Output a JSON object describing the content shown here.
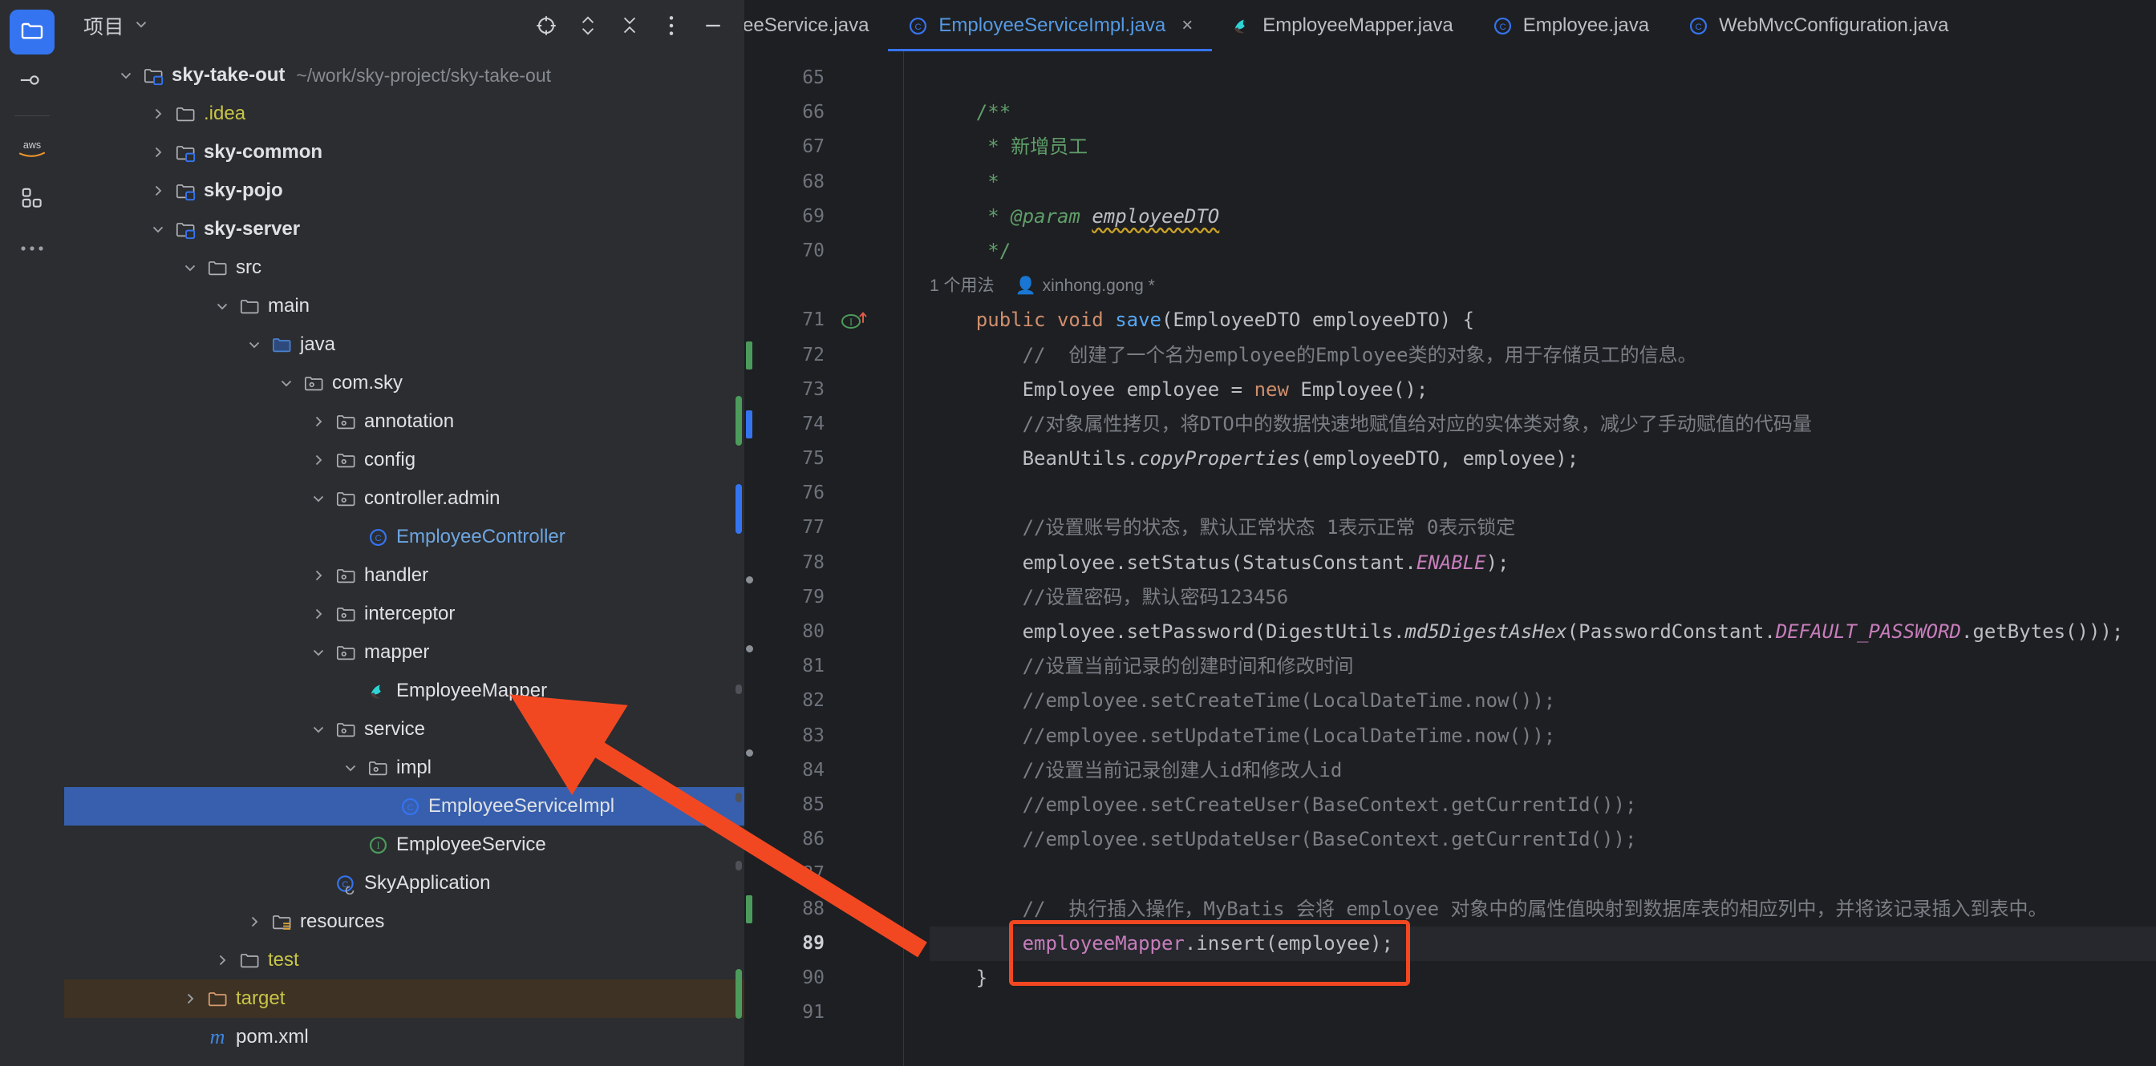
{
  "rail": {
    "items": [
      {
        "name": "project-tool-window",
        "icon": "folder-icon",
        "active": true
      },
      {
        "name": "commit-tool-window",
        "icon": "commit-icon",
        "active": false
      },
      {
        "name": "aws-toolkit",
        "icon": "aws-icon",
        "label": "aws",
        "active": false
      },
      {
        "name": "plugins-tool-window",
        "icon": "modules-icon",
        "active": false
      },
      {
        "name": "more-tool-windows",
        "icon": "more-dots-icon",
        "active": false
      }
    ]
  },
  "project_panel": {
    "title": "项目",
    "title_dropdown_icon": "chevron-down-icon",
    "header_icons": [
      {
        "name": "select-opened-file-icon",
        "glyph": "crosshair-icon"
      },
      {
        "name": "expand-collapse-icon",
        "glyph": "chevron-up-down-icon"
      },
      {
        "name": "collapse-all-icon",
        "glyph": "double-chevron-up-icon"
      },
      {
        "name": "options-menu-icon",
        "glyph": "vertical-dots-icon"
      },
      {
        "name": "hide-tool-window-icon",
        "glyph": "minus-icon"
      }
    ],
    "tree": [
      {
        "indent": 0,
        "arrow": "down",
        "icon": "module-folder",
        "label": "sky-take-out",
        "bold": true,
        "path": "~/work/sky-project/sky-take-out"
      },
      {
        "indent": 1,
        "arrow": "right",
        "icon": "folder",
        "label": ".idea",
        "color": "yellowish"
      },
      {
        "indent": 1,
        "arrow": "right",
        "icon": "module-folder",
        "label": "sky-common",
        "bold": true
      },
      {
        "indent": 1,
        "arrow": "right",
        "icon": "module-folder",
        "label": "sky-pojo",
        "bold": true
      },
      {
        "indent": 1,
        "arrow": "down",
        "icon": "module-folder",
        "label": "sky-server",
        "bold": true
      },
      {
        "indent": 2,
        "arrow": "down",
        "icon": "folder",
        "label": "src"
      },
      {
        "indent": 3,
        "arrow": "down",
        "icon": "folder",
        "label": "main"
      },
      {
        "indent": 4,
        "arrow": "down",
        "icon": "source-root-folder",
        "label": "java"
      },
      {
        "indent": 5,
        "arrow": "down",
        "icon": "package",
        "label": "com.sky"
      },
      {
        "indent": 6,
        "arrow": "right",
        "icon": "package",
        "label": "annotation"
      },
      {
        "indent": 6,
        "arrow": "right",
        "icon": "package",
        "label": "config"
      },
      {
        "indent": 6,
        "arrow": "down",
        "icon": "package",
        "label": "controller.admin"
      },
      {
        "indent": 7,
        "arrow": "none",
        "icon": "java-class",
        "label": "EmployeeController",
        "color": "classname"
      },
      {
        "indent": 6,
        "arrow": "right",
        "icon": "package",
        "label": "handler"
      },
      {
        "indent": 6,
        "arrow": "right",
        "icon": "package",
        "label": "interceptor"
      },
      {
        "indent": 6,
        "arrow": "down",
        "icon": "package",
        "label": "mapper"
      },
      {
        "indent": 7,
        "arrow": "none",
        "icon": "mybatis-mapper",
        "label": "EmployeeMapper"
      },
      {
        "indent": 6,
        "arrow": "down",
        "icon": "package",
        "label": "service"
      },
      {
        "indent": 7,
        "arrow": "down",
        "icon": "package",
        "label": "impl"
      },
      {
        "indent": 8,
        "arrow": "none",
        "icon": "java-class",
        "label": "EmployeeServiceImpl",
        "selected": true
      },
      {
        "indent": 7,
        "arrow": "none",
        "icon": "java-interface",
        "label": "EmployeeService"
      },
      {
        "indent": 6,
        "arrow": "none",
        "icon": "spring-boot-class",
        "label": "SkyApplication"
      },
      {
        "indent": 4,
        "arrow": "right",
        "icon": "resources-folder",
        "label": "resources"
      },
      {
        "indent": 3,
        "arrow": "right",
        "icon": "folder",
        "label": "test",
        "color": "yellowish"
      },
      {
        "indent": 2,
        "arrow": "right",
        "icon": "excluded-folder",
        "label": "target",
        "color": "yellowish",
        "excluded": true
      },
      {
        "indent": 2,
        "arrow": "none",
        "icon": "maven-file",
        "label": "pom.xml"
      }
    ]
  },
  "editor": {
    "tabs": [
      {
        "label": "yeeService.java",
        "icon": "java-interface",
        "active": false,
        "clipped": true,
        "closable": false
      },
      {
        "label": "EmployeeServiceImpl.java",
        "icon": "java-class",
        "active": true,
        "clipped": false,
        "closable": true,
        "close_label": "×"
      },
      {
        "label": "EmployeeMapper.java",
        "icon": "mybatis-mapper",
        "active": false,
        "clipped": false,
        "closable": false
      },
      {
        "label": "Employee.java",
        "icon": "java-class",
        "active": false,
        "clipped": false,
        "closable": false
      },
      {
        "label": "WebMvcConfiguration.java",
        "icon": "java-class",
        "active": false,
        "clipped": false,
        "closable": false
      }
    ],
    "first_line_number": 65,
    "line_numbers": [
      65,
      66,
      67,
      68,
      69,
      70,
      "",
      71,
      72,
      73,
      74,
      75,
      76,
      77,
      78,
      79,
      80,
      81,
      82,
      83,
      84,
      85,
      86,
      87,
      88,
      89,
      90,
      91
    ],
    "current_line": 89,
    "gutter": {
      "change_bars": [
        {
          "line": 72,
          "color": "#4C9B5C",
          "name": "added-line-marker"
        },
        {
          "line": 74,
          "color": "#3574F0",
          "name": "modified-line-marker"
        },
        {
          "line": 88,
          "color": "#4C9B5C",
          "name": "added-line-marker"
        }
      ],
      "fold_dots": [
        78,
        80,
        83
      ],
      "implementation_icon": {
        "line": 71,
        "name": "implementing-method-icon",
        "glyph": "I"
      }
    },
    "inlay_hints": {
      "usages": "1 个用法",
      "author": "xinhong.gong *",
      "author_icon": "person-icon"
    },
    "lines": [
      {
        "n": 65,
        "segments": []
      },
      {
        "n": 66,
        "segments": [
          {
            "c": "doc",
            "t": "    /**"
          }
        ]
      },
      {
        "n": 67,
        "segments": [
          {
            "c": "doc",
            "t": "     * 新增员工"
          }
        ]
      },
      {
        "n": 68,
        "segments": [
          {
            "c": "doc",
            "t": "     *"
          }
        ]
      },
      {
        "n": 69,
        "segments": [
          {
            "c": "doc",
            "t": "     * "
          },
          {
            "c": "doctag",
            "t": "@param "
          },
          {
            "c": "docpar",
            "t": "employeeDTO"
          }
        ]
      },
      {
        "n": 70,
        "segments": [
          {
            "c": "doc",
            "t": "     */"
          }
        ]
      },
      {
        "n": 71,
        "segments": [
          {
            "c": "kw",
            "t": "    public void "
          },
          {
            "c": "mth",
            "t": "save"
          },
          {
            "c": "txt",
            "t": "(EmployeeDTO employeeDTO) {"
          }
        ]
      },
      {
        "n": 72,
        "segments": [
          {
            "c": "cmt",
            "t": "        //  创建了一个名为employee的Employee类的对象，用于存储员工的信息。"
          }
        ]
      },
      {
        "n": 73,
        "segments": [
          {
            "c": "txt",
            "t": "        Employee employee = "
          },
          {
            "c": "kw",
            "t": "new "
          },
          {
            "c": "txt",
            "t": "Employee();"
          }
        ]
      },
      {
        "n": 74,
        "segments": [
          {
            "c": "cmt",
            "t": "        //对象属性拷贝，将DTO中的数据快速地赋值给对应的实体类对象，减少了手动赋值的代码量"
          }
        ]
      },
      {
        "n": 75,
        "segments": [
          {
            "c": "txt",
            "t": "        BeanUtils."
          },
          {
            "c": "static",
            "t": "copyProperties"
          },
          {
            "c": "txt",
            "t": "(employeeDTO, employee);"
          }
        ]
      },
      {
        "n": 76,
        "segments": []
      },
      {
        "n": 77,
        "segments": [
          {
            "c": "cmt",
            "t": "        //设置账号的状态，默认正常状态 1表示正常 0表示锁定"
          }
        ]
      },
      {
        "n": 78,
        "segments": [
          {
            "c": "txt",
            "t": "        employee.setStatus(StatusConstant."
          },
          {
            "c": "const",
            "t": "ENABLE"
          },
          {
            "c": "txt",
            "t": ");"
          }
        ]
      },
      {
        "n": 79,
        "segments": [
          {
            "c": "cmt",
            "t": "        //设置密码，默认密码123456"
          }
        ]
      },
      {
        "n": 80,
        "segments": [
          {
            "c": "txt",
            "t": "        employee.setPassword(DigestUtils."
          },
          {
            "c": "static",
            "t": "md5DigestAsHex"
          },
          {
            "c": "txt",
            "t": "(PasswordConstant."
          },
          {
            "c": "const",
            "t": "DEFAULT_PASSWORD"
          },
          {
            "c": "txt",
            "t": ".getBytes()));"
          }
        ]
      },
      {
        "n": 81,
        "segments": [
          {
            "c": "cmt",
            "t": "        //设置当前记录的创建时间和修改时间"
          }
        ]
      },
      {
        "n": 82,
        "segments": [
          {
            "c": "cmt",
            "t": "        //employee.setCreateTime(LocalDateTime.now());"
          }
        ]
      },
      {
        "n": 83,
        "segments": [
          {
            "c": "cmt",
            "t": "        //employee.setUpdateTime(LocalDateTime.now());"
          }
        ]
      },
      {
        "n": 84,
        "segments": [
          {
            "c": "cmt",
            "t": "        //设置当前记录创建人id和修改人id"
          }
        ]
      },
      {
        "n": 85,
        "segments": [
          {
            "c": "cmt",
            "t": "        //employee.setCreateUser(BaseContext.getCurrentId());"
          }
        ]
      },
      {
        "n": 86,
        "segments": [
          {
            "c": "cmt",
            "t": "        //employee.setUpdateUser(BaseContext.getCurrentId());"
          }
        ]
      },
      {
        "n": 87,
        "segments": []
      },
      {
        "n": 88,
        "segments": [
          {
            "c": "cmt",
            "t": "        //  执行插入操作，MyBatis 会将 employee 对象中的属性值映射到数据库表的相应列中，并将该记录插入到表中。"
          }
        ]
      },
      {
        "n": 89,
        "segments": [
          {
            "c": "fld",
            "t": "        employeeMapper"
          },
          {
            "c": "txt",
            "t": ".insert(employee);"
          }
        ],
        "highlighted": true
      },
      {
        "n": 90,
        "segments": [
          {
            "c": "txt",
            "t": "    }"
          }
        ]
      },
      {
        "n": 91,
        "segments": []
      }
    ]
  },
  "annotation": {
    "highlight_box": {
      "name": "red-highlight-box",
      "color": "#F24822",
      "target_line": 89
    },
    "arrow": {
      "name": "red-arrow-annotation",
      "color": "#F24822",
      "from": "line-89",
      "to": "EmployeeMapper-tree-item"
    }
  },
  "colors": {
    "accent": "#3574F0",
    "panel_bg": "#2B2D30",
    "editor_bg": "#1E1F22",
    "selection": "#375FAD",
    "excluded": "#3D3223",
    "annotation_red": "#F24822"
  }
}
